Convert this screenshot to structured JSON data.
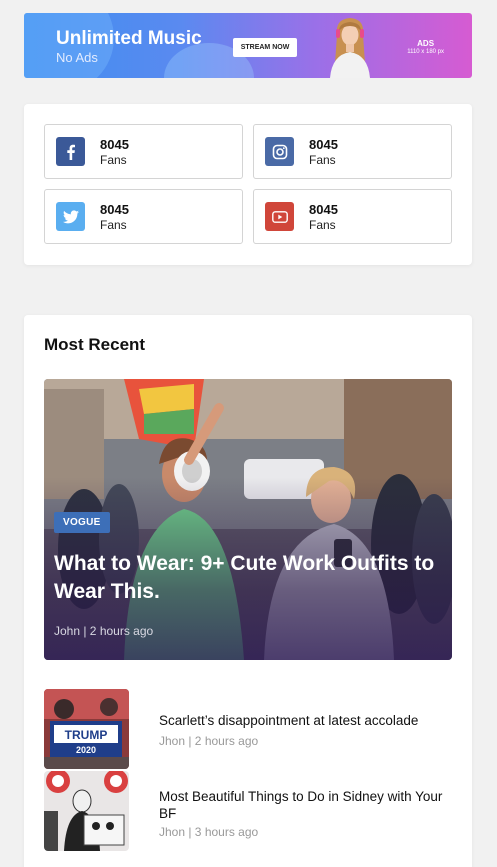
{
  "ad": {
    "title": "Unlimited Music",
    "subtitle": "No Ads",
    "cta": "STREAM NOW",
    "label": "ADS",
    "size": "1110 x 180 px"
  },
  "social": {
    "items": [
      {
        "network": "facebook",
        "icon": "facebook-icon",
        "color": "#3b5998",
        "count": "8045",
        "unit": "Fans"
      },
      {
        "network": "instagram",
        "icon": "instagram-icon",
        "color": "#4a6aa6",
        "count": "8045",
        "unit": "Fans"
      },
      {
        "network": "twitter",
        "icon": "twitter-icon",
        "color": "#5aaef0",
        "count": "8045",
        "unit": "Fans"
      },
      {
        "network": "youtube",
        "icon": "youtube-icon",
        "color": "#d0463a",
        "count": "8045",
        "unit": "Fans"
      }
    ]
  },
  "recent": {
    "heading": "Most Recent",
    "featured": {
      "category": "VOGUE",
      "title": "What to Wear: 9+ Cute Work Outfits to Wear This.",
      "meta": "John | 2 hours ago"
    },
    "posts": [
      {
        "title": "Scarlett’s disappointment at latest accolade",
        "meta": "Jhon | 2 hours ago"
      },
      {
        "title": "Most Beautiful Things to Do in Sidney with Your BF",
        "meta": "Jhon | 3 hours ago"
      }
    ]
  }
}
